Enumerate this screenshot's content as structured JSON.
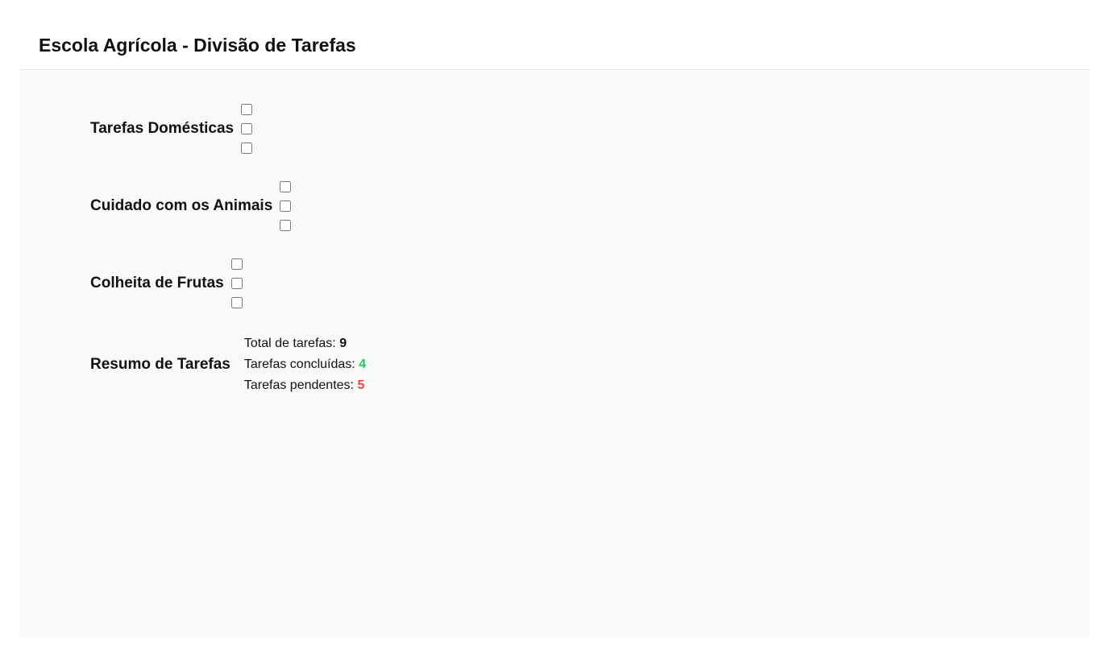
{
  "header": {
    "title": "Escola Agrícola - Divisão de Tarefas"
  },
  "groups": [
    {
      "title": "Tarefas Domésticas",
      "checkboxes": [
        {
          "checked": false
        },
        {
          "checked": false
        },
        {
          "checked": false
        }
      ]
    },
    {
      "title": "Cuidado com os Animais",
      "checkboxes": [
        {
          "checked": false
        },
        {
          "checked": false
        },
        {
          "checked": false
        }
      ]
    },
    {
      "title": "Colheita de Frutas",
      "checkboxes": [
        {
          "checked": false
        },
        {
          "checked": false
        },
        {
          "checked": false
        }
      ]
    }
  ],
  "summary": {
    "title": "Resumo de Tarefas",
    "total_label": "Total de tarefas:",
    "total_value": "9",
    "done_label": "Tarefas concluídas:",
    "done_value": "4",
    "pending_label": "Tarefas pendentes:",
    "pending_value": "5"
  },
  "colors": {
    "done": "#22c55e",
    "pending": "#ef4444",
    "panel_background": "#f8faf9"
  }
}
